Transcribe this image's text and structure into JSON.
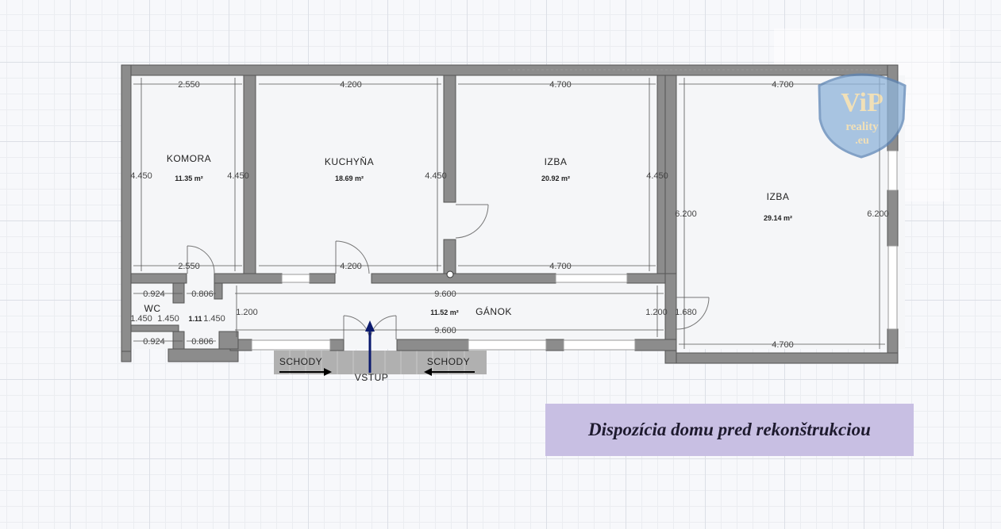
{
  "rooms": [
    {
      "name": "KOMORA",
      "area": "11.35 m²"
    },
    {
      "name": "KUCHYŇA",
      "area": "18.69 m²"
    },
    {
      "name": "IZBA",
      "area": "20.92 m²"
    },
    {
      "name": "IZBA",
      "area": "29.14 m²"
    },
    {
      "name": "GÁNOK",
      "area": "11.52 m²"
    },
    {
      "name": "WC",
      "area": "1.11"
    }
  ],
  "dimensions": {
    "komora_top": "2.550",
    "komora_bottom": "2.550",
    "komora_left": "4.450",
    "komora_right": "4.450",
    "kuchyna_top": "4.200",
    "kuchyna_bottom": "4.200",
    "kuchyna_right": "4.450",
    "izba1_top": "4.700",
    "izba1_bottom": "4.700",
    "izba1_right": "4.450",
    "izba2_top": "4.700",
    "izba2_bottom": "4.700",
    "izba2_left": "6.200",
    "izba2_right": "6.200",
    "ganok_top": "9.600",
    "ganok_bottom": "9.600",
    "ganok_left": "1.200",
    "ganok_right": "1.200",
    "door_gap": "1.680",
    "wc_top_a": "0.924",
    "wc_top_b": "0.806",
    "wc_bottom_a": "0.924",
    "wc_bottom_b": "0.806",
    "wc_left": "1.450",
    "wc_mid": "1.450",
    "wc_right": "1.450"
  },
  "labels": {
    "stairs_left": "SCHODY",
    "stairs_right": "SCHODY",
    "entrance": "VSTUP"
  },
  "logo": {
    "text_top": "ViP",
    "text_mid": "reality",
    "text_bottom": ".eu"
  },
  "caption": "Dispozícia domu pred rekonštrukciou",
  "colors": {
    "wall": "#8c8c8c",
    "wall_edge": "#555555",
    "arrow": "#0b1a6e",
    "caption_bg": "#c8bfe3"
  }
}
